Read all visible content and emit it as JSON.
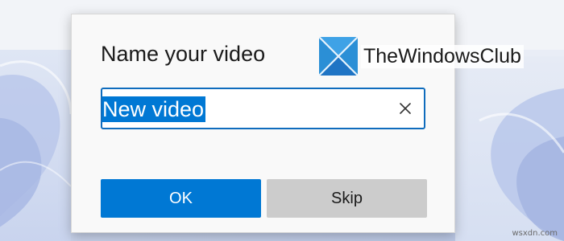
{
  "dialog": {
    "title": "Name your video",
    "input_value": "New video",
    "ok_label": "OK",
    "skip_label": "Skip"
  },
  "watermark": {
    "site": "TheWindowsClub"
  },
  "credit": "wsxdn.com",
  "icons": {
    "clear": "close-icon",
    "logo": "twc-logo-icon"
  },
  "colors": {
    "accent": "#0078d4",
    "skip_bg": "#cccccc",
    "dialog_bg": "#f9f9f9"
  }
}
